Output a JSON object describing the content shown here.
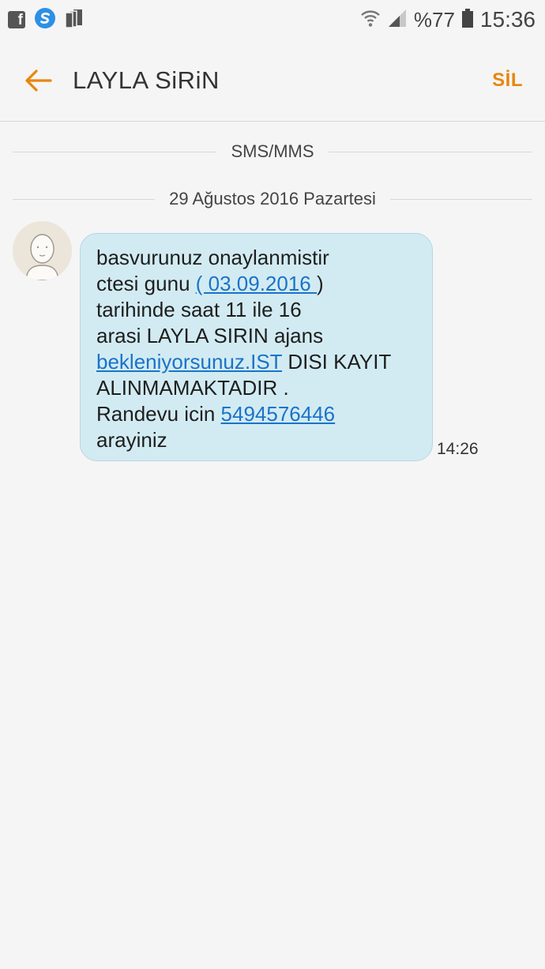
{
  "status_bar": {
    "battery_percent": "%77",
    "time": "15:36"
  },
  "header": {
    "title": "LAYLA SiRiN",
    "delete_label": "SİL"
  },
  "conversation": {
    "channel_label": "SMS/MMS",
    "date_label": "29 Ağustos 2016 Pazartesi"
  },
  "message": {
    "line1": "basvurunuz onaylanmistir",
    "line2_prefix": "ctesi gunu ",
    "line2_link": "( 03.09.2016 ",
    "line2_suffix": ")",
    "line3": "tarihinde saat 11 ile 16",
    "line4": "arasi LAYLA SIRIN ajans",
    "line5_link": "bekleniyorsunuz.IST",
    "line5_suffix": " DISI KAYIT",
    "line6": "ALINMAMAKTADIR .",
    "line7_prefix": "Randevu icin ",
    "line7_link": "5494576446",
    "line8": "arayiniz",
    "time": "14:26"
  },
  "colors": {
    "accent": "#e8860d",
    "bubble": "#d2ebf2",
    "link": "#1a73c9"
  }
}
